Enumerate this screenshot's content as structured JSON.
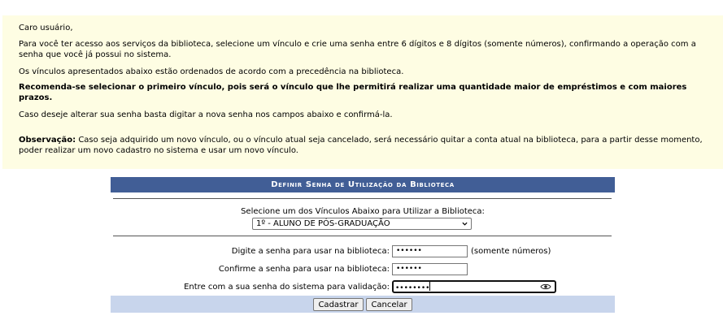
{
  "notice": {
    "greeting": "Caro usuário,",
    "intro": "Para você ter acesso aos serviços da biblioteca, selecione um vínculo e crie uma senha entre 6 dígitos e 8 dígitos (somente números), confirmando a operação com a senha que você já possui no sistema.",
    "order": "Os vínculos apresentados abaixo estão ordenados de acordo com a precedência na biblioteca.",
    "recommend": "Recomenda-se selecionar o primeiro vínculo, pois será o vínculo que lhe permitirá realizar uma quantidade maior de empréstimos e com maiores prazos.",
    "change": "Caso deseje alterar sua senha basta digitar a nova senha nos campos abaixo e confirmá-la.",
    "obs_label": "Observação:",
    "obs_text": " Caso seja adquirido um novo vínculo, ou o vínculo atual seja cancelado, será necessário quitar a conta atual na biblioteca, para a partir desse momento, poder realizar um novo cadastro no sistema e usar um novo vínculo."
  },
  "form": {
    "title": "Definir Senha de Utilização da Biblioteca",
    "vinculo_label": "Selecione um dos Vínculos Abaixo para Utilizar a Biblioteca:",
    "vinculo_selected": "1º - ALUNO DE PÓS-GRADUAÇÃO",
    "password_label": "Digite a senha para usar na biblioteca:",
    "password_value": "••••••",
    "password_hint": "(somente números)",
    "confirm_label": "Confirme a senha para usar na biblioteca:",
    "confirm_value": "••••••",
    "system_label": "Entre com a sua senha do sistema para validação:",
    "system_value": "••••••••",
    "save_label": "Cadastrar",
    "cancel_label": "Cancelar"
  },
  "colors": {
    "notice_bg": "#fefde3",
    "header_bg": "#415e96",
    "footer_bg": "#c8d5ec"
  },
  "icons": {
    "select_arrow": "chevron-down-icon",
    "reveal_password": "eye-icon"
  }
}
